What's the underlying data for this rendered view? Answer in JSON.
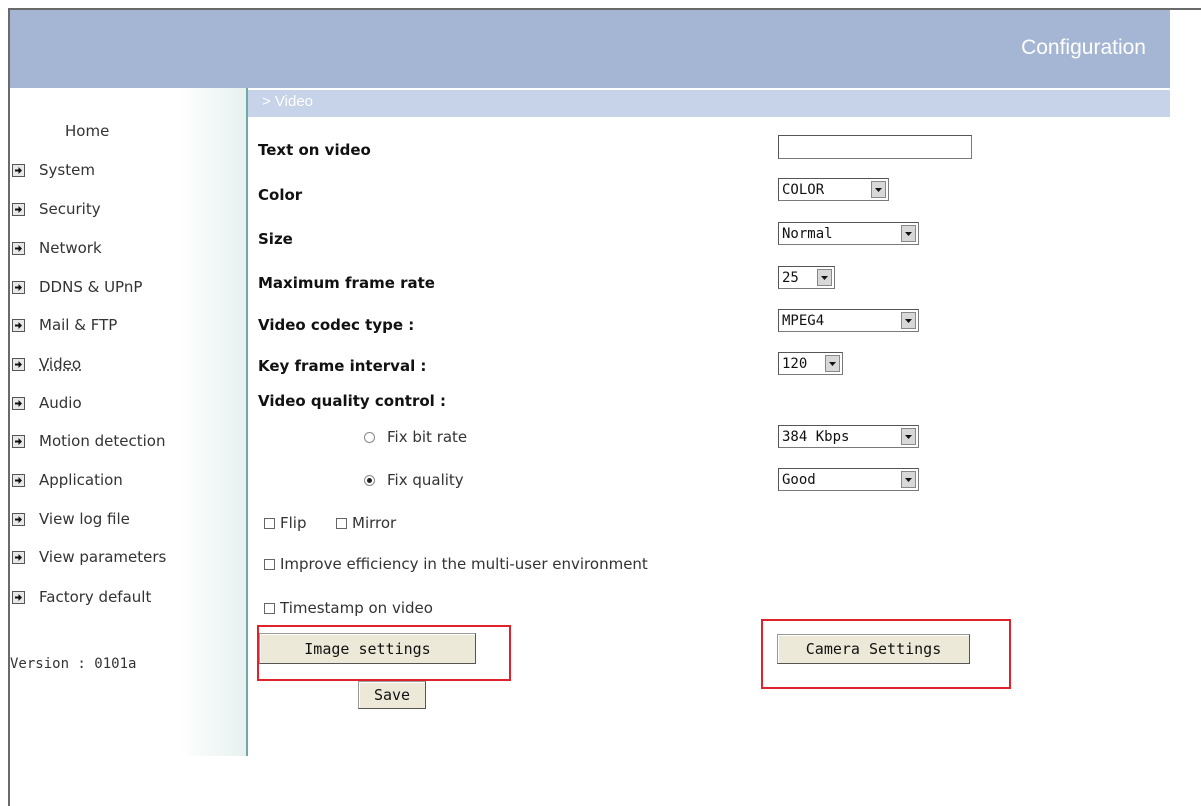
{
  "header": {
    "title": "Configuration"
  },
  "breadcrumb": "> Video",
  "sidebar": {
    "home": "Home",
    "items": [
      {
        "label": "System"
      },
      {
        "label": "Security"
      },
      {
        "label": "Network"
      },
      {
        "label": "DDNS & UPnP"
      },
      {
        "label": "Mail & FTP"
      },
      {
        "label": "Video"
      },
      {
        "label": "Audio"
      },
      {
        "label": "Motion detection"
      },
      {
        "label": "Application"
      },
      {
        "label": "View log file"
      },
      {
        "label": "View parameters"
      },
      {
        "label": "Factory default"
      }
    ],
    "version": "Version : 0101a"
  },
  "form": {
    "text_on_video": {
      "label": "Text on video",
      "value": ""
    },
    "color": {
      "label": "Color",
      "value": "COLOR"
    },
    "size": {
      "label": "Size",
      "value": "Normal"
    },
    "max_frame_rate": {
      "label": "Maximum frame rate",
      "value": "25"
    },
    "codec": {
      "label": "Video codec type :",
      "value": "MPEG4"
    },
    "key_frame": {
      "label": "Key frame interval :",
      "value": "120"
    },
    "quality_control": {
      "label": "Video quality control :",
      "fix_bit_rate": {
        "label": "Fix bit rate",
        "value": "384 Kbps",
        "checked": false
      },
      "fix_quality": {
        "label": "Fix quality",
        "value": "Good",
        "checked": true
      }
    },
    "flip": {
      "label": "Flip",
      "checked": false
    },
    "mirror": {
      "label": "Mirror",
      "checked": false
    },
    "multiuser": {
      "label": "Improve efficiency in the multi-user environment",
      "checked": false
    },
    "timestamp": {
      "label": "Timestamp on video",
      "checked": false
    }
  },
  "buttons": {
    "image_settings": "Image settings",
    "camera_settings": "Camera  Settings",
    "save": "Save"
  },
  "colors": {
    "header_bg": "#a4b6d3",
    "crumb_bg": "#c6d3e8",
    "highlight": "#e0232a"
  }
}
